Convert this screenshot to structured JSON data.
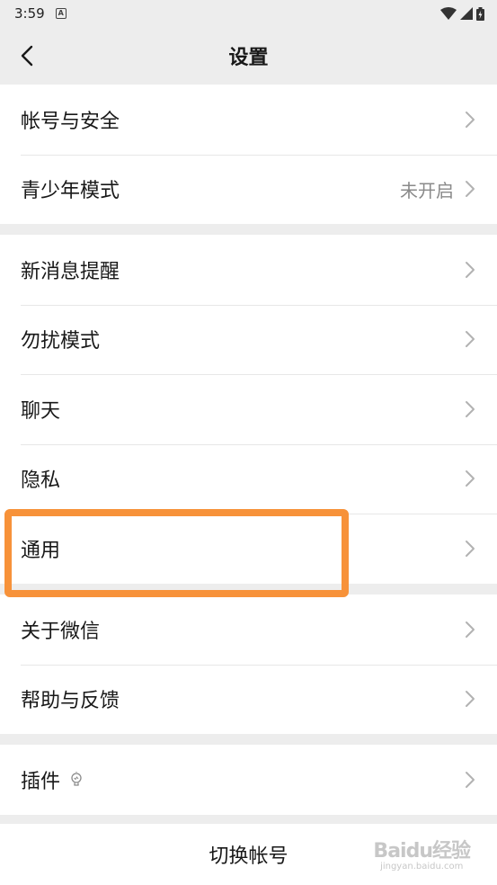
{
  "status_bar": {
    "time": "3:59",
    "notification_glyph": "A",
    "icons": [
      "wifi-icon",
      "signal-icon",
      "battery-icon"
    ]
  },
  "nav": {
    "title": "设置",
    "back_icon": "chevron-left-icon"
  },
  "groups": [
    {
      "items": [
        {
          "label": "帐号与安全"
        },
        {
          "label": "青少年模式",
          "value": "未开启"
        }
      ]
    },
    {
      "items": [
        {
          "label": "新消息提醒"
        },
        {
          "label": "勿扰模式"
        },
        {
          "label": "聊天"
        },
        {
          "label": "隐私"
        },
        {
          "label": "通用",
          "highlighted": true
        }
      ]
    },
    {
      "items": [
        {
          "label": "关于微信"
        },
        {
          "label": "帮助与反馈"
        }
      ]
    },
    {
      "items": [
        {
          "label": "插件",
          "icon": "lightbulb-icon"
        }
      ]
    }
  ],
  "switch_account": {
    "label": "切换帐号"
  },
  "watermark": {
    "main": "Baidu经验",
    "sub": "jingyan.baidu.com"
  },
  "colors": {
    "background": "#ededed",
    "card": "#ffffff",
    "highlight": "#f7923a",
    "secondary_text": "#8a8a8a",
    "chevron": "#b2b2b2"
  }
}
